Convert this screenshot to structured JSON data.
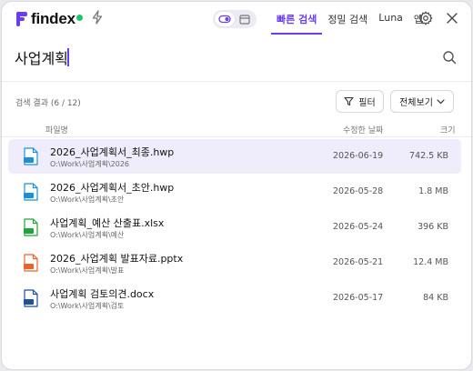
{
  "app": {
    "brand": "findex",
    "status_color": "#21c36a",
    "accent": "#6a3df0"
  },
  "tabs": [
    {
      "label": "빠른 검색",
      "active": true
    },
    {
      "label": "정밀 검색",
      "active": false
    },
    {
      "label": "Luna",
      "active": false
    },
    {
      "label": "앱",
      "active": false
    }
  ],
  "search": {
    "value": "사업계획",
    "icon": "search-icon"
  },
  "results": {
    "count_label": "검색 결과 (6 / 12)",
    "filter_label": "필터",
    "view_label": "전체보기",
    "columns": {
      "name": "파일명",
      "date": "수정한 날짜",
      "size": "크기"
    },
    "files": [
      {
        "name": "2026_사업계획서_최종.hwp",
        "path": "O:\\Work\\사업계획\\2026",
        "date": "2026-06-19",
        "size": "742.5 KB",
        "type": "hwp",
        "icon_color": "#1e8fd6",
        "selected": true
      },
      {
        "name": "2026_사업계획서_초안.hwp",
        "path": "O:\\Work\\사업계획\\초안",
        "date": "2026-05-28",
        "size": "1.8 MB",
        "type": "hwp",
        "icon_color": "#1e8fd6",
        "selected": false
      },
      {
        "name": "사업계획_예산 산출표.xlsx",
        "path": "O:\\Work\\사업계획\\예산",
        "date": "2026-05-24",
        "size": "396 KB",
        "type": "xlsx",
        "icon_color": "#21a33a",
        "selected": false
      },
      {
        "name": "2026_사업계획 발표자료.pptx",
        "path": "O:\\Work\\사업계획\\발표",
        "date": "2026-05-21",
        "size": "12.4 MB",
        "type": "pptx",
        "icon_color": "#e8642c",
        "selected": false
      },
      {
        "name": "사업계획 검토의견.docx",
        "path": "O:\\Work\\사업계획\\검토",
        "date": "2026-05-17",
        "size": "84 KB",
        "type": "docx",
        "icon_color": "#1f4f9e",
        "selected": false
      }
    ]
  }
}
